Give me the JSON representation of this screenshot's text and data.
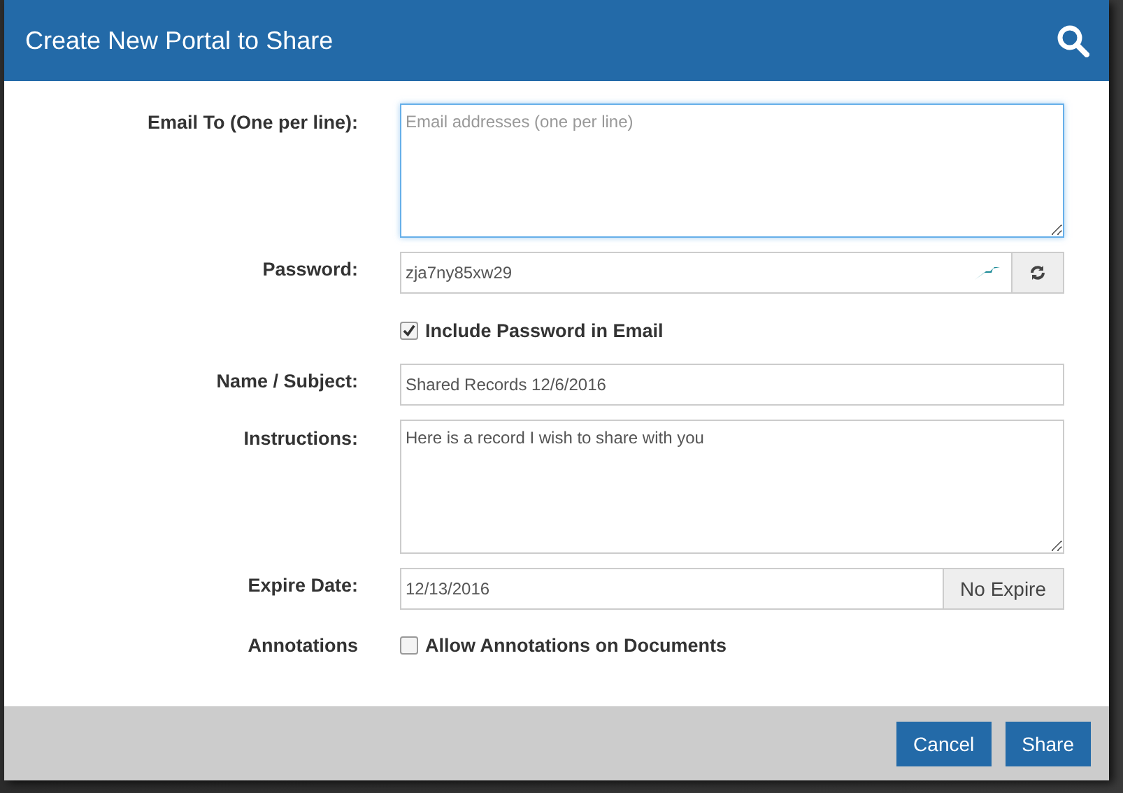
{
  "dialog": {
    "title": "Create New Portal to Share"
  },
  "form": {
    "email": {
      "label": "Email To (One per line):",
      "placeholder": "Email addresses (one per line)"
    },
    "password": {
      "label": "Password:",
      "value": "zja7ny85xw29"
    },
    "include_password": {
      "label": "Include Password in Email",
      "checked": true
    },
    "name": {
      "label": "Name / Subject:",
      "value": "Shared Records 12/6/2016"
    },
    "instructions": {
      "label": "Instructions:",
      "value": "Here is a record I wish to share with you"
    },
    "expire": {
      "label": "Expire Date:",
      "value": "12/13/2016",
      "button": "No Expire"
    },
    "annotations": {
      "label": "Annotations",
      "option": "Allow Annotations on Documents",
      "checked": false
    }
  },
  "buttons": [
    {
      "label": "Cancel"
    },
    {
      "label": "Share"
    }
  ]
}
